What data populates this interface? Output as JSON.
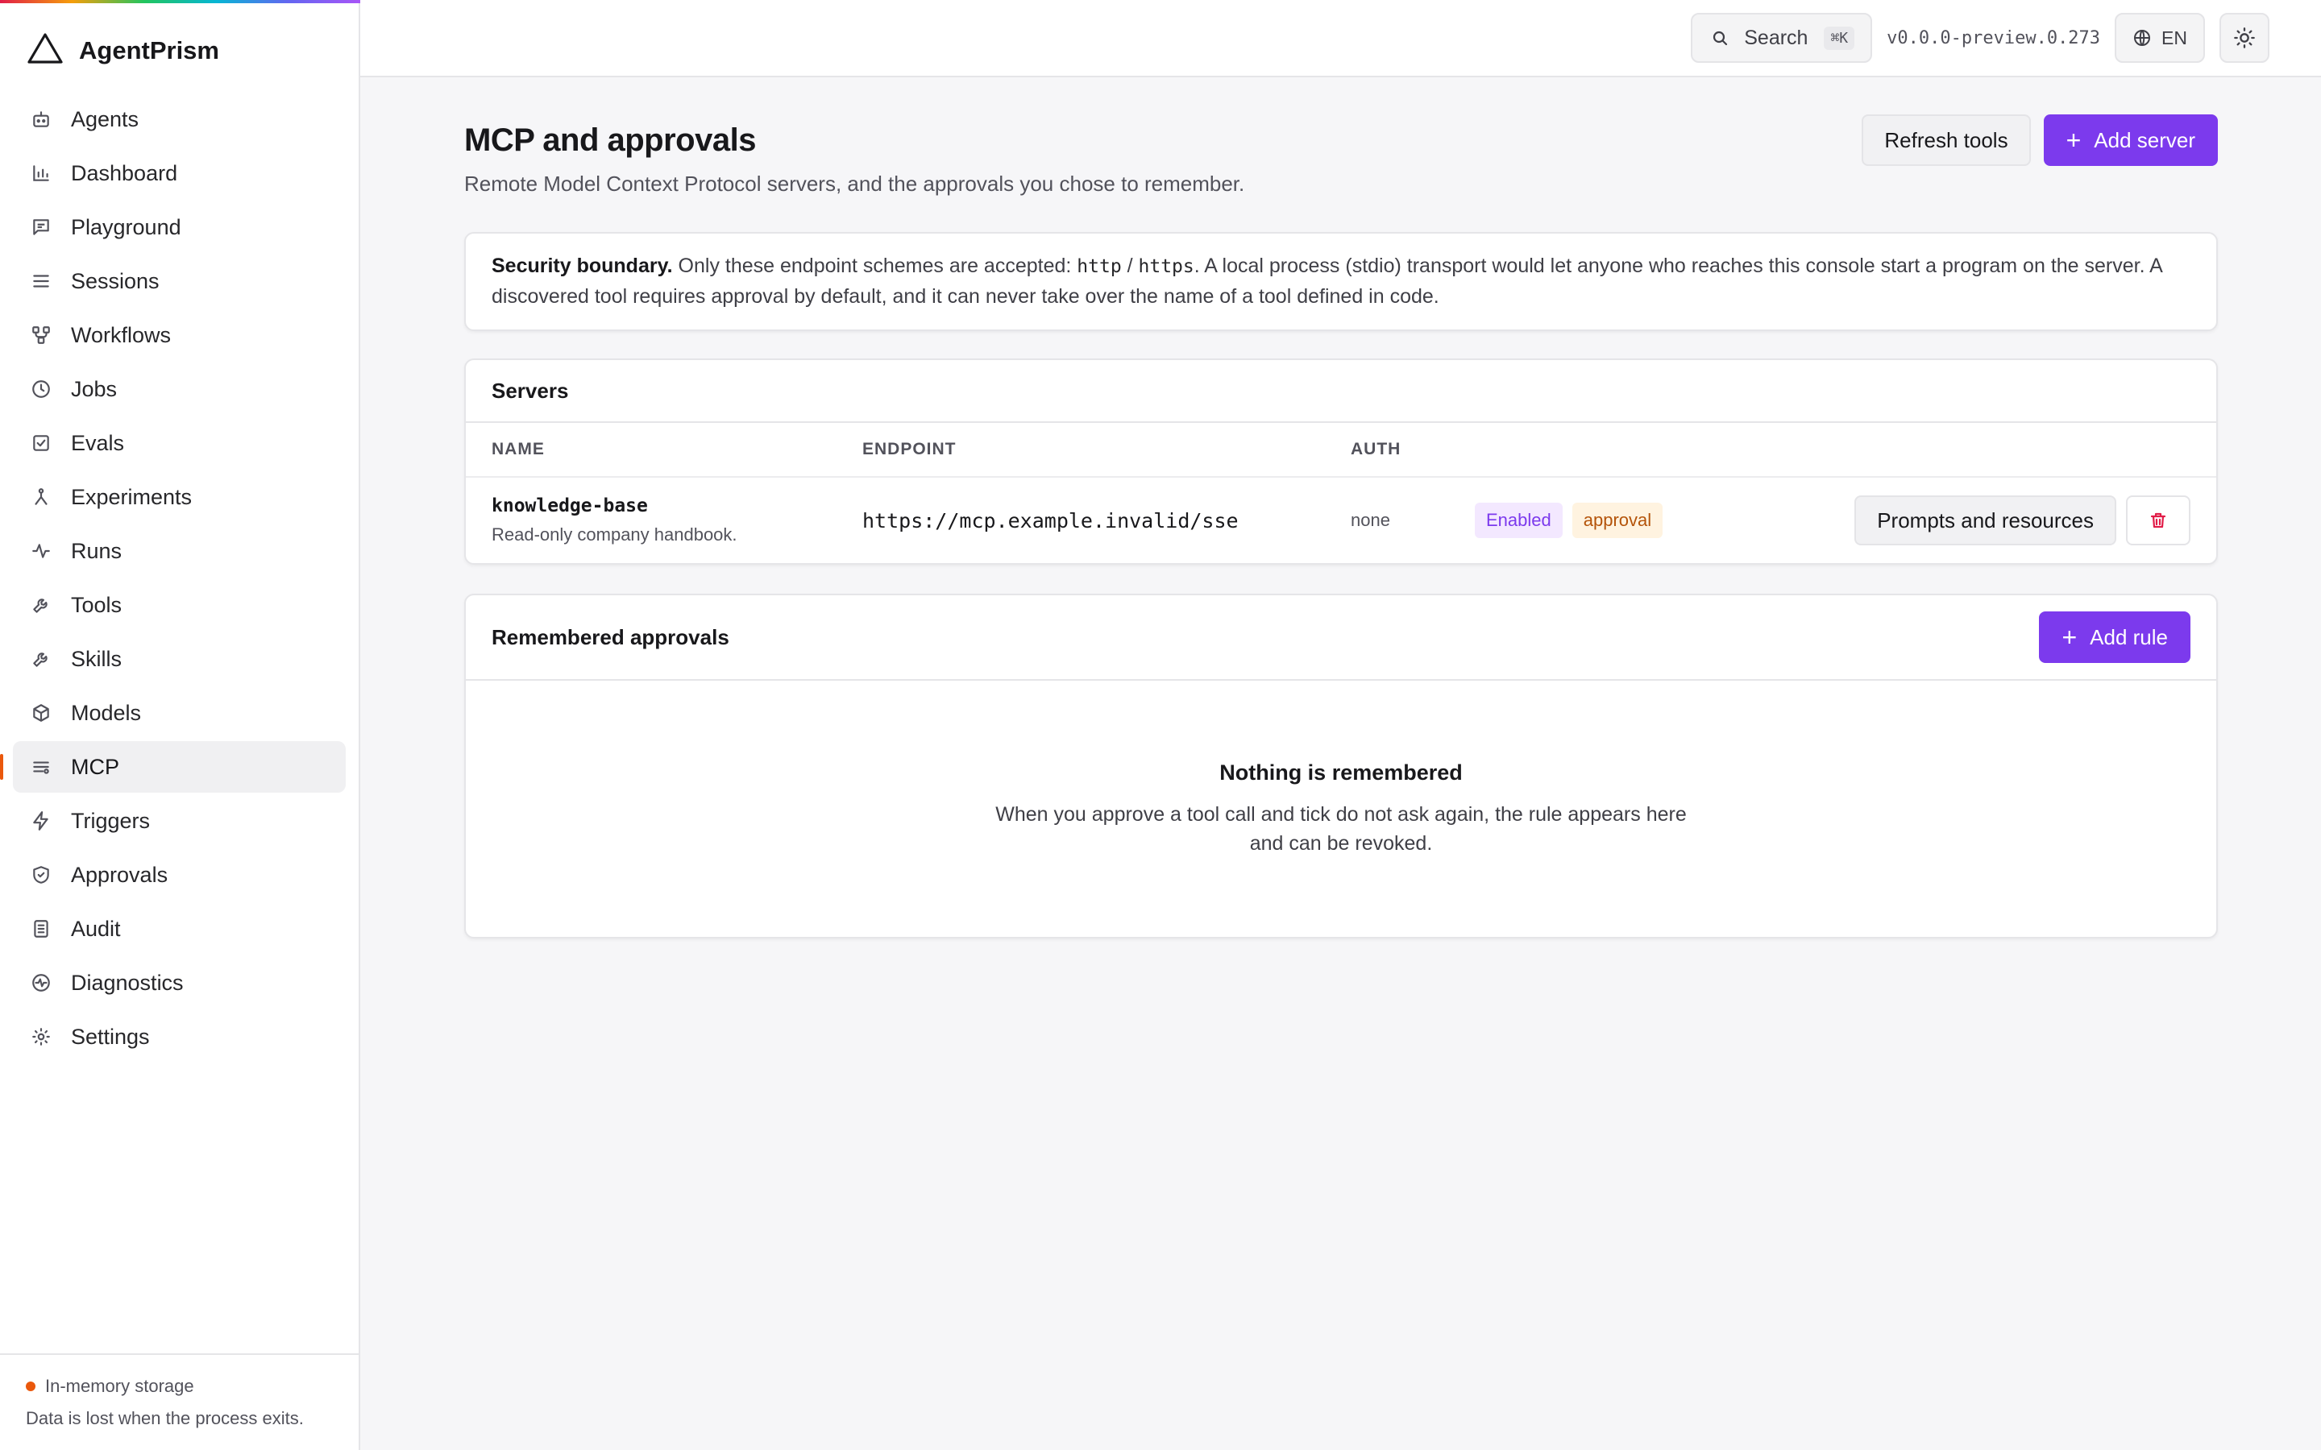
{
  "app": {
    "name": "AgentPrism"
  },
  "sidebar": {
    "items": [
      {
        "label": "Agents"
      },
      {
        "label": "Dashboard"
      },
      {
        "label": "Playground"
      },
      {
        "label": "Sessions"
      },
      {
        "label": "Workflows"
      },
      {
        "label": "Jobs"
      },
      {
        "label": "Evals"
      },
      {
        "label": "Experiments"
      },
      {
        "label": "Runs"
      },
      {
        "label": "Tools"
      },
      {
        "label": "Skills"
      },
      {
        "label": "Models"
      },
      {
        "label": "MCP",
        "active": true
      },
      {
        "label": "Triggers"
      },
      {
        "label": "Approvals"
      },
      {
        "label": "Audit"
      },
      {
        "label": "Diagnostics"
      },
      {
        "label": "Settings"
      }
    ],
    "storage": {
      "title": "In-memory storage",
      "note": "Data is lost when the process exits."
    }
  },
  "topbar": {
    "search_label": "Search",
    "search_shortcut": "⌘K",
    "version": "v0.0.0-preview.0.273",
    "language": "EN"
  },
  "page": {
    "title": "MCP and approvals",
    "subtitle": "Remote Model Context Protocol servers, and the approvals you chose to remember.",
    "refresh_label": "Refresh tools",
    "add_server_label": "Add server"
  },
  "notice": {
    "heading": "Security boundary.",
    "text_1": " Only these endpoint schemes are accepted: ",
    "scheme_http": "http",
    "sep": " / ",
    "scheme_https": "https",
    "text_2": ". A local process (stdio) transport would let anyone who reaches this console start a program on the server. A discovered tool requires approval by default, and it can never take over the name of a tool defined in code."
  },
  "servers": {
    "title": "Servers",
    "columns": {
      "name": "NAME",
      "endpoint": "ENDPOINT",
      "auth": "AUTH"
    },
    "rows": [
      {
        "name": "knowledge-base",
        "description": "Read-only company handbook.",
        "endpoint": "https://mcp.example.invalid/sse",
        "auth": "none",
        "status_badge": "Enabled",
        "policy_badge": "approval",
        "prompts_label": "Prompts and resources"
      }
    ]
  },
  "approvals": {
    "title": "Remembered approvals",
    "add_rule_label": "Add rule",
    "empty_title": "Nothing is remembered",
    "empty_desc": "When you approve a tool call and tick do not ask again, the rule appears here and can be revoked."
  },
  "colors": {
    "accent": "#7c3aed",
    "active_indicator": "#ea580c",
    "enabled_badge_text": "#7c3aed",
    "approval_badge_text": "#b45309",
    "delete_icon": "#e11d48"
  },
  "icons": {
    "brand": "triangle-logo-icon",
    "search": "search-icon",
    "language": "globe-icon",
    "theme": "sun-icon",
    "delete": "trash-icon"
  }
}
